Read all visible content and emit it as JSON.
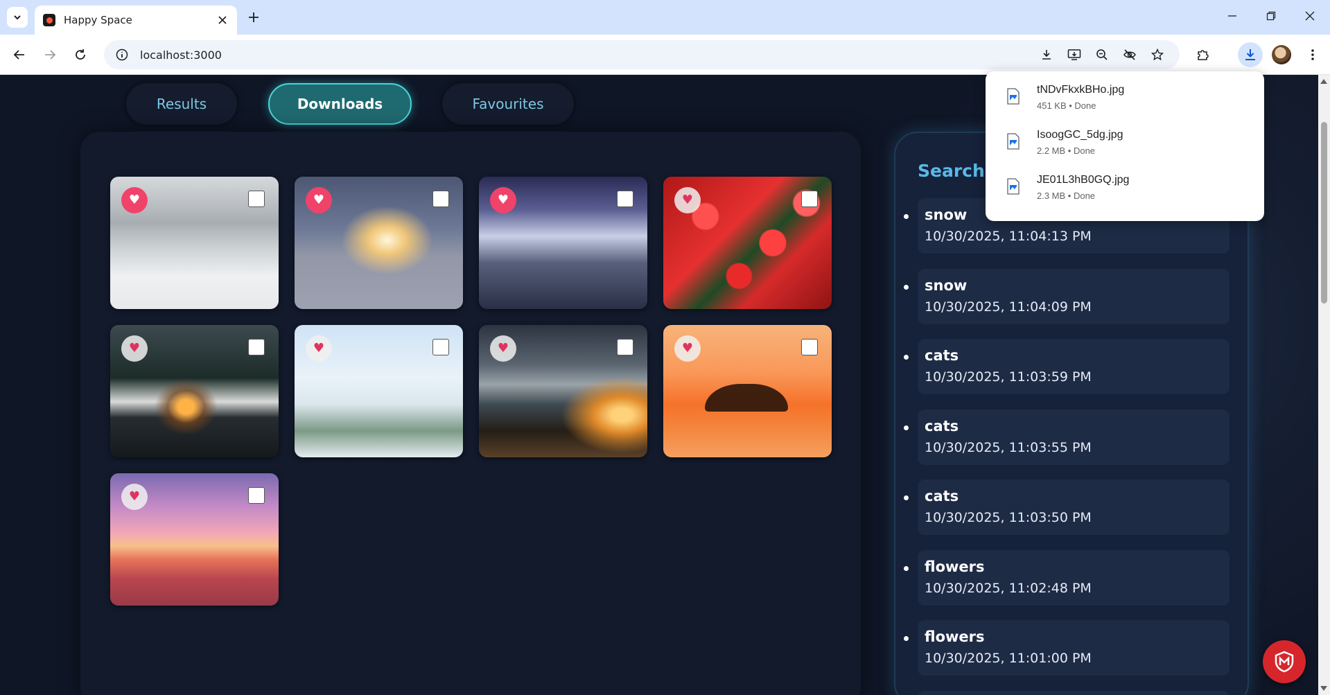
{
  "browser": {
    "tab_title": "Happy Space",
    "url": "localhost:3000"
  },
  "page": {
    "nav_tabs": [
      {
        "label": "Results",
        "active": false
      },
      {
        "label": "Downloads",
        "active": true
      },
      {
        "label": "Favourites",
        "active": false
      }
    ],
    "images": [
      {
        "name": "church-mountain-snow",
        "favourite": true,
        "selected": false
      },
      {
        "name": "snow-sunrise-pine",
        "favourite": true,
        "selected": false
      },
      {
        "name": "snowy-valley",
        "favourite": true,
        "selected": false
      },
      {
        "name": "red-roses",
        "favourite": false,
        "selected": false
      },
      {
        "name": "snowy-cabin-lake",
        "favourite": false,
        "selected": false
      },
      {
        "name": "frosted-trees",
        "favourite": false,
        "selected": false
      },
      {
        "name": "sunset-beach-clouds",
        "favourite": false,
        "selected": false
      },
      {
        "name": "orange-sunset-island",
        "favourite": false,
        "selected": false
      },
      {
        "name": "purple-sunset-beach",
        "favourite": false,
        "selected": false
      }
    ],
    "history": {
      "title": "Search H",
      "items": [
        {
          "term": "snow",
          "time": "10/30/2025, 11:04:13 PM"
        },
        {
          "term": "snow",
          "time": "10/30/2025, 11:04:09 PM"
        },
        {
          "term": "cats",
          "time": "10/30/2025, 11:03:59 PM"
        },
        {
          "term": "cats",
          "time": "10/30/2025, 11:03:55 PM"
        },
        {
          "term": "cats",
          "time": "10/30/2025, 11:03:50 PM"
        },
        {
          "term": "flowers",
          "time": "10/30/2025, 11:02:48 PM"
        },
        {
          "term": "flowers",
          "time": "10/30/2025, 11:01:00 PM"
        }
      ]
    }
  },
  "downloads": [
    {
      "name": "tNDvFkxkBHo.jpg",
      "status": "451 KB • Done"
    },
    {
      "name": "IsoogGC_5dg.jpg",
      "status": "2.2 MB • Done"
    },
    {
      "name": "JE01L3hB0GQ.jpg",
      "status": "2.3 MB • Done"
    }
  ],
  "colors": {
    "accent": "#47d4d9",
    "heart_on": "#f0436a",
    "history_title": "#5ab8e8",
    "page_bg": "#0f1626"
  }
}
